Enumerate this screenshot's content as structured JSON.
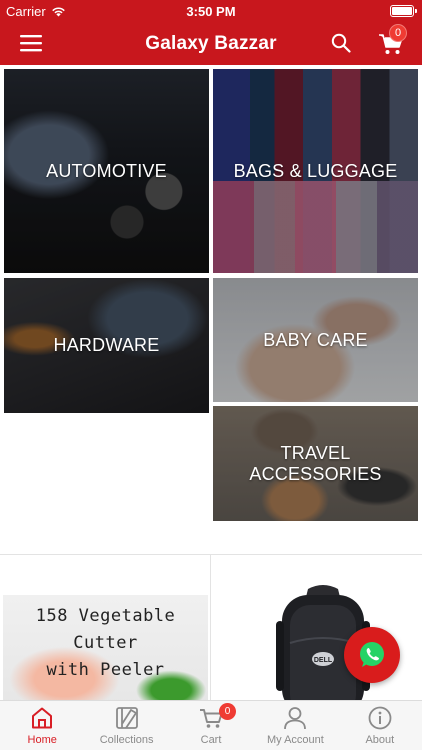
{
  "status_bar": {
    "carrier": "Carrier",
    "time": "3:50 PM"
  },
  "header": {
    "title": "Galaxy Bazzar",
    "cart_count": "0"
  },
  "categories": [
    {
      "label": "AUTOMOTIVE"
    },
    {
      "label": "BAGS & LUGGAGE"
    },
    {
      "label": "HARDWARE"
    },
    {
      "label": "BABY CARE"
    },
    {
      "label": "TRAVEL ACCESSORIES"
    }
  ],
  "products": [
    {
      "title_line1": "158 Vegetable Cutter",
      "title_line2": "with Peeler"
    },
    {
      "logo": "DELL"
    }
  ],
  "tabbar": {
    "items": [
      {
        "label": "Home",
        "icon": "home-icon"
      },
      {
        "label": "Collections",
        "icon": "collections-icon"
      },
      {
        "label": "Cart",
        "icon": "cart-icon",
        "badge": "0"
      },
      {
        "label": "My Account",
        "icon": "account-icon"
      },
      {
        "label": "About",
        "icon": "info-icon"
      }
    ],
    "active": "Home"
  },
  "colors": {
    "brand_red": "#c8171d",
    "badge_red": "#ef3b33",
    "active_tab": "#d81e25",
    "inactive_tab": "#8a8a8a"
  }
}
